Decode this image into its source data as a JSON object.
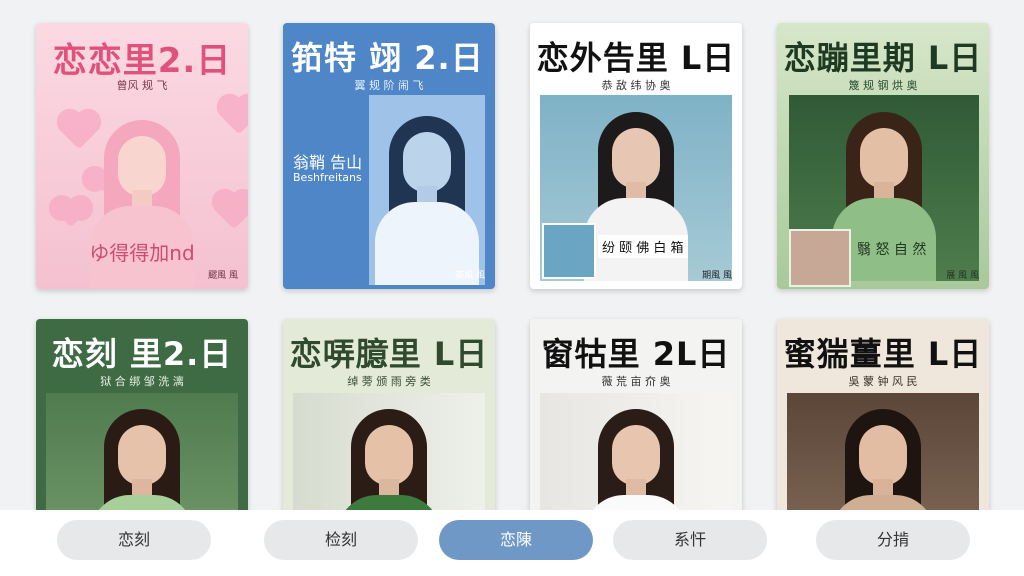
{
  "cards": [
    {
      "title": "恋恋里2.日",
      "subtitle": "曾风 规 飞",
      "foot": "飂風 風",
      "extra": "ゆ得得加nd"
    },
    {
      "title": "筘特 翊 2.日",
      "subtitle": "翼 规 阶 闹 飞",
      "foot": "英風 風",
      "extra": "翁鞘 告山",
      "extra2": "Beshfreitans"
    },
    {
      "title": "恋外告里 L日",
      "subtitle": "恭 敌 纬 协 奥",
      "foot": "期風 風",
      "extra": "纷 颐 佛 白 箱"
    },
    {
      "title": "恋蹦里期 L日",
      "subtitle": "篾 规 钢 烘 奥",
      "foot": "展 風 風",
      "extra": "翳 怒 自 然"
    },
    {
      "title": "恋刻 里2.日",
      "subtitle": "狱 合 绑 邹 洗 漓"
    },
    {
      "title": "恋哢臆里 L日",
      "subtitle": "绰 蒡 颁 雨 旁 类"
    },
    {
      "title": "窗牯里 2L日",
      "subtitle": "薇 荒 亩 夼 奥"
    },
    {
      "title": "蜜猯薑里 L日",
      "subtitle": "吳 蒙 钟 风 民"
    }
  ],
  "tabs": [
    {
      "label": "恋刻"
    },
    {
      "label": "检刻"
    },
    {
      "label": "恋陳"
    },
    {
      "label": "系忓"
    },
    {
      "label": "分掯"
    }
  ],
  "active_tab": 2,
  "colors": {
    "accent": "#6f98c6",
    "pink": "#f6c7d4",
    "blue": "#4f86c8",
    "green": "#3f6b44"
  }
}
